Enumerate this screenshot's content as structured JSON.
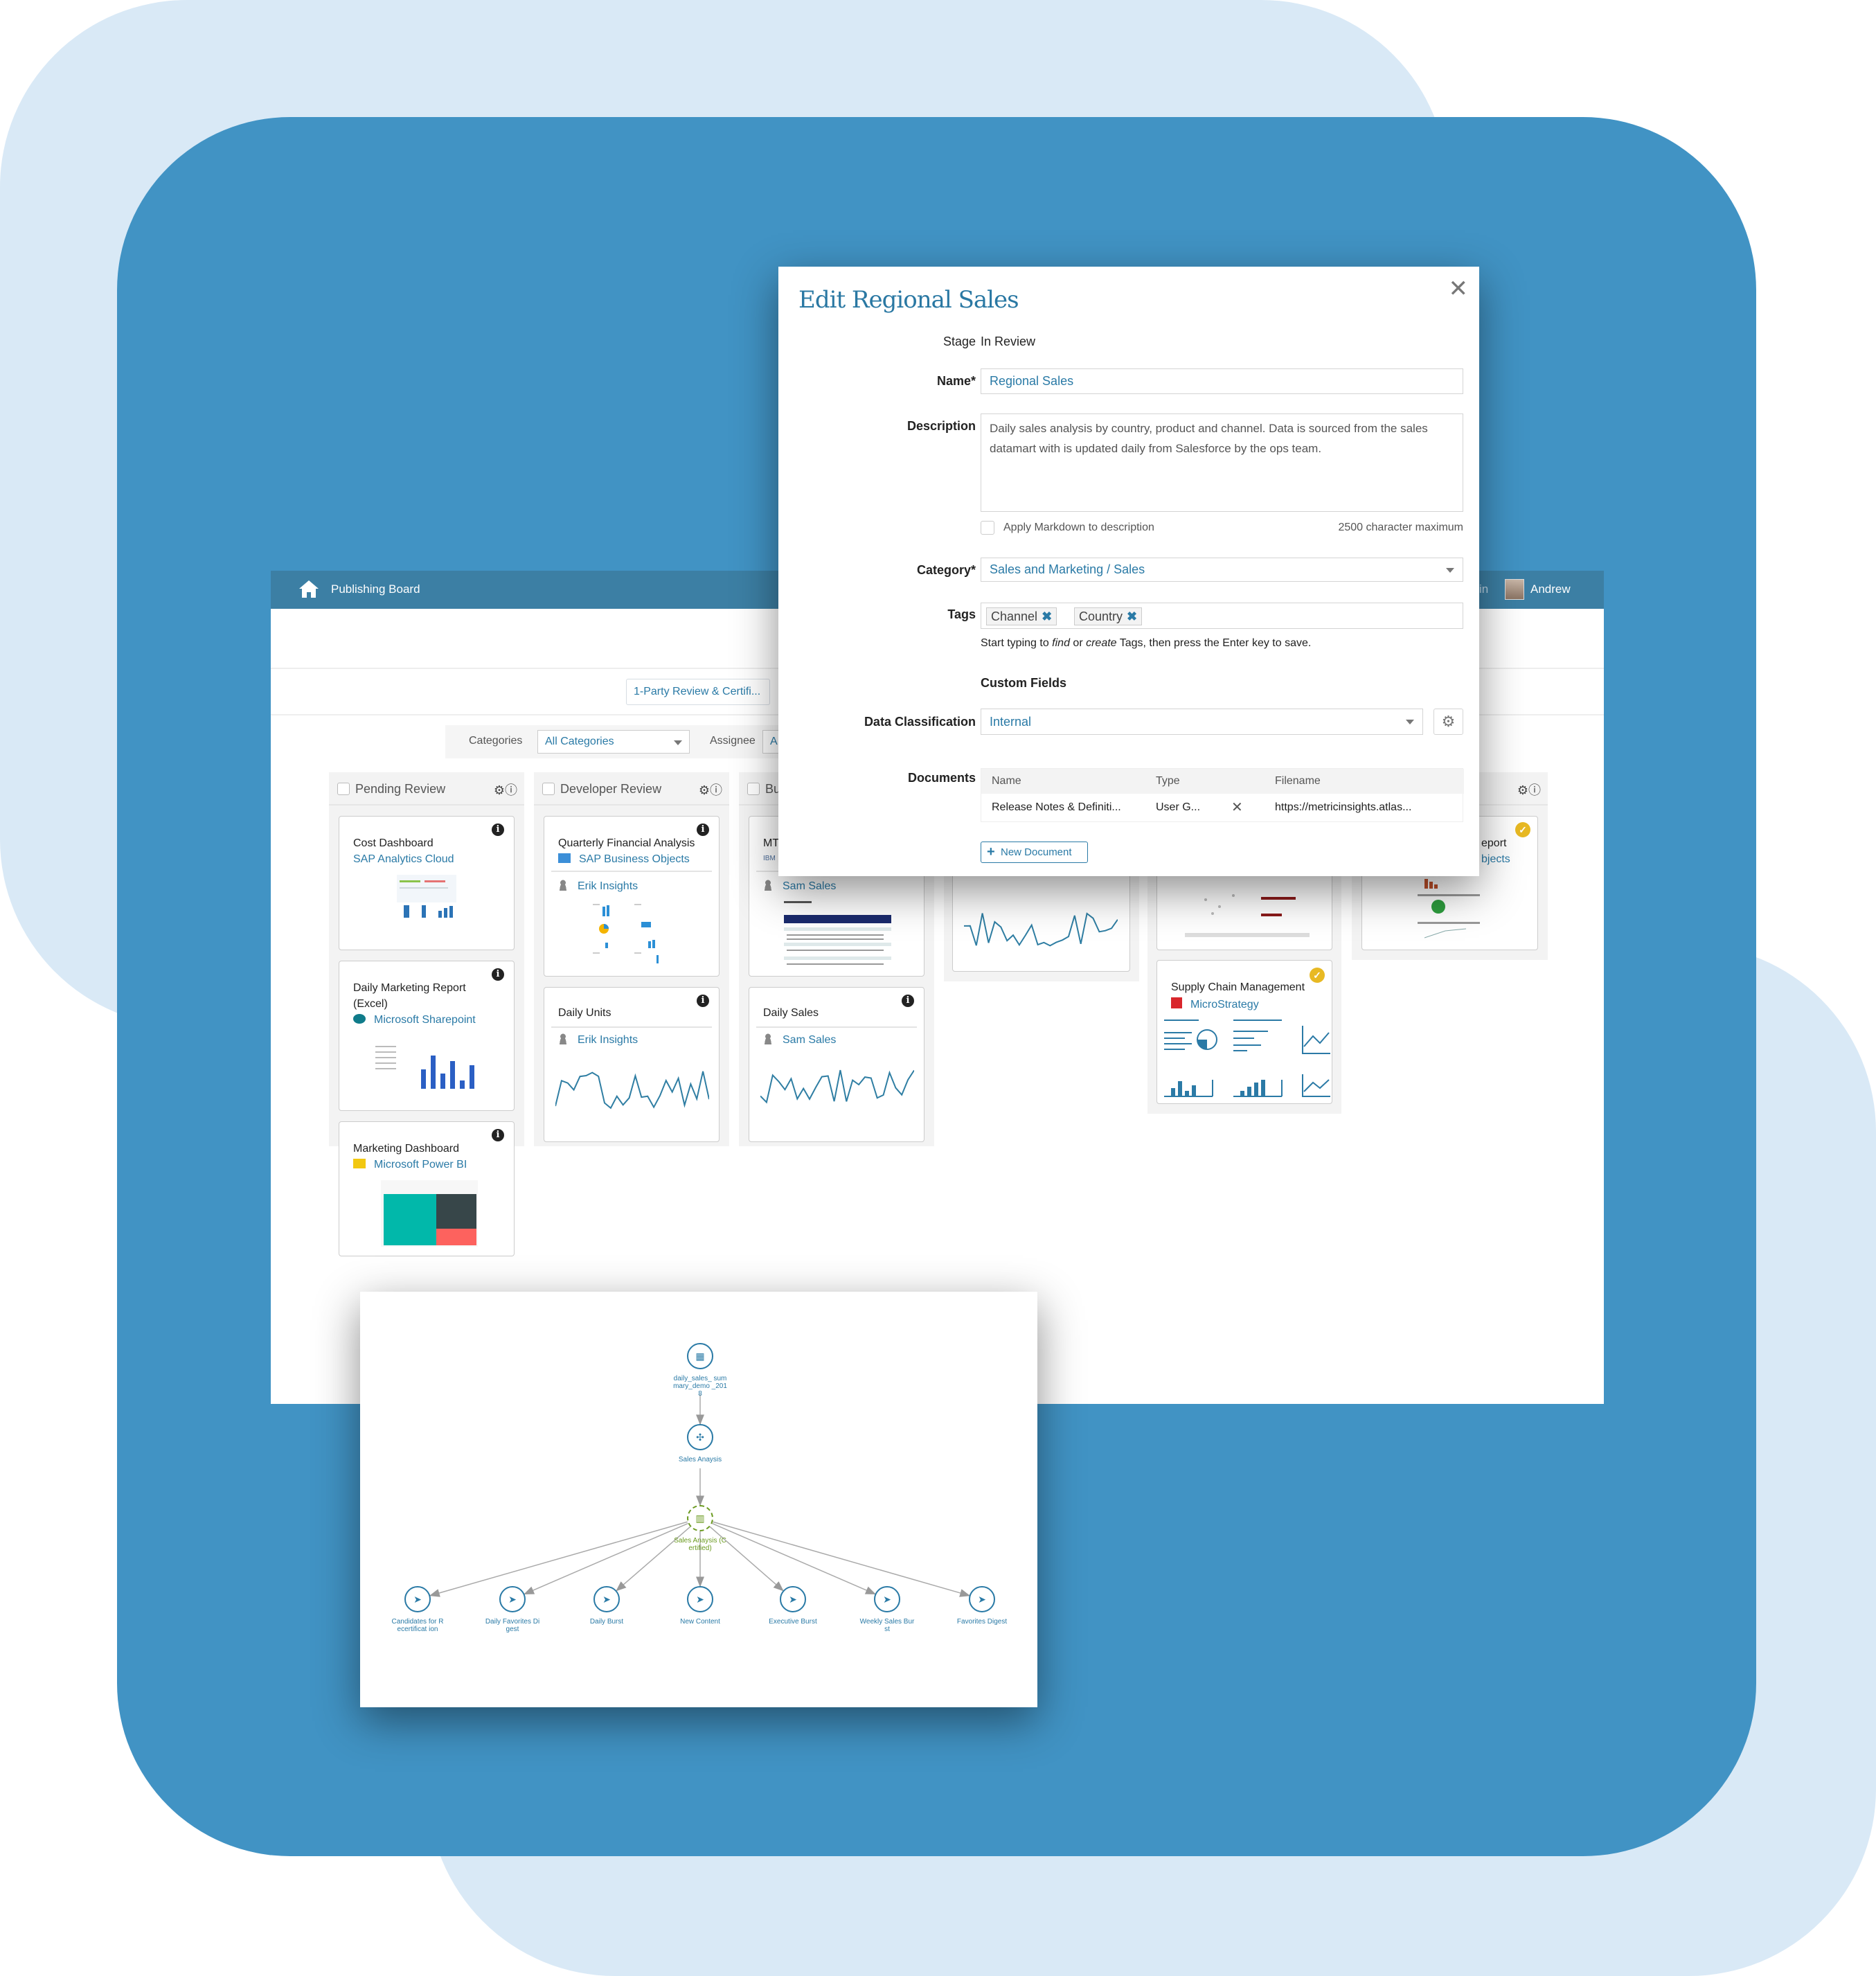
{
  "colors": {
    "accent": "#2a7aa6",
    "header": "#3c7fa4",
    "frame": "#4193c4",
    "backdrop": "#d9e9f6",
    "certified": "#6a9a1f",
    "badge": "#e8b923"
  },
  "app": {
    "title": "Publishing Board",
    "home_icon": "home-icon",
    "user_name": "Andrew",
    "header_partial_text": "in"
  },
  "toolbar": {
    "workflow_button": "1-Party Review & Certifi..."
  },
  "filters": {
    "categories_label": "Categories",
    "categories_value": "All Categories",
    "assignee_label": "Assignee",
    "assignee_value": "A"
  },
  "columns": [
    {
      "name": "Pending Review",
      "cards": [
        {
          "title": "Cost Dashboard",
          "source": "SAP Analytics Cloud"
        },
        {
          "title": "Daily Marketing Report",
          "title2": "(Excel)",
          "source": "Microsoft Sharepoint"
        },
        {
          "title": "Marketing Dashboard",
          "source": "Microsoft Power BI"
        }
      ]
    },
    {
      "name": "Developer Review",
      "cards": [
        {
          "title": "Quarterly Financial Analysis",
          "source": "SAP Business Objects",
          "owner": "Erik Insights"
        },
        {
          "title": "Daily Units",
          "owner": "Erik Insights"
        }
      ]
    },
    {
      "name": "Bu",
      "cards": [
        {
          "title": "MTI",
          "source": "IBM",
          "owner": "Sam Sales"
        },
        {
          "title": "Daily Sales",
          "owner": "Sam Sales"
        }
      ]
    },
    {
      "name": "",
      "cards": []
    },
    {
      "name": "",
      "cards": [
        {
          "title": "Supply Chain Management",
          "source": "MicroStrategy",
          "certified": true
        }
      ]
    },
    {
      "name": "",
      "cards": [
        {
          "title": "eport",
          "source": "bjects",
          "certified": true
        }
      ]
    }
  ],
  "modal": {
    "title": "Edit Regional Sales",
    "stage_label": "Stage",
    "stage_value": "In Review",
    "name_label": "Name*",
    "name_value": "Regional Sales",
    "description_label": "Description",
    "description_value": "Daily sales analysis by country, product and channel. Data is sourced from the sales datamart with is updated daily from Salesforce by the ops team.",
    "markdown_label": "Apply Markdown to description",
    "markdown_checked": false,
    "char_limit": "2500 character maximum",
    "category_label": "Category*",
    "category_value": "Sales and Marketing / Sales",
    "tags_label": "Tags",
    "tags": [
      "Channel",
      "Country"
    ],
    "tags_hint_1": "Start typing to ",
    "tags_hint_find": "find",
    "tags_hint_2": " or ",
    "tags_hint_create": "create",
    "tags_hint_3": " Tags, then press the Enter key to save.",
    "custom_fields_heading": "Custom Fields",
    "data_classification_label": "Data Classification",
    "data_classification_value": "Internal",
    "documents_label": "Documents",
    "documents_columns": [
      "Name",
      "Type",
      "Filename"
    ],
    "documents_rows": [
      {
        "name": "Release Notes & Definiti...",
        "type": "User G...",
        "filename": "https://metricinsights.atlas..."
      }
    ],
    "new_document_label": "New Document"
  },
  "lineage": {
    "source": "daily_sales_ summary_demo _2018",
    "workbook": "Sales Anaysis",
    "certified": "Sales Anaysis (Certified)",
    "targets": [
      "Candidates for Recertificat ion",
      "Daily Favorites Digest",
      "Daily Burst",
      "New Content",
      "Executive Burst",
      "Weekly Sales Burst",
      "Favorites Digest"
    ]
  }
}
